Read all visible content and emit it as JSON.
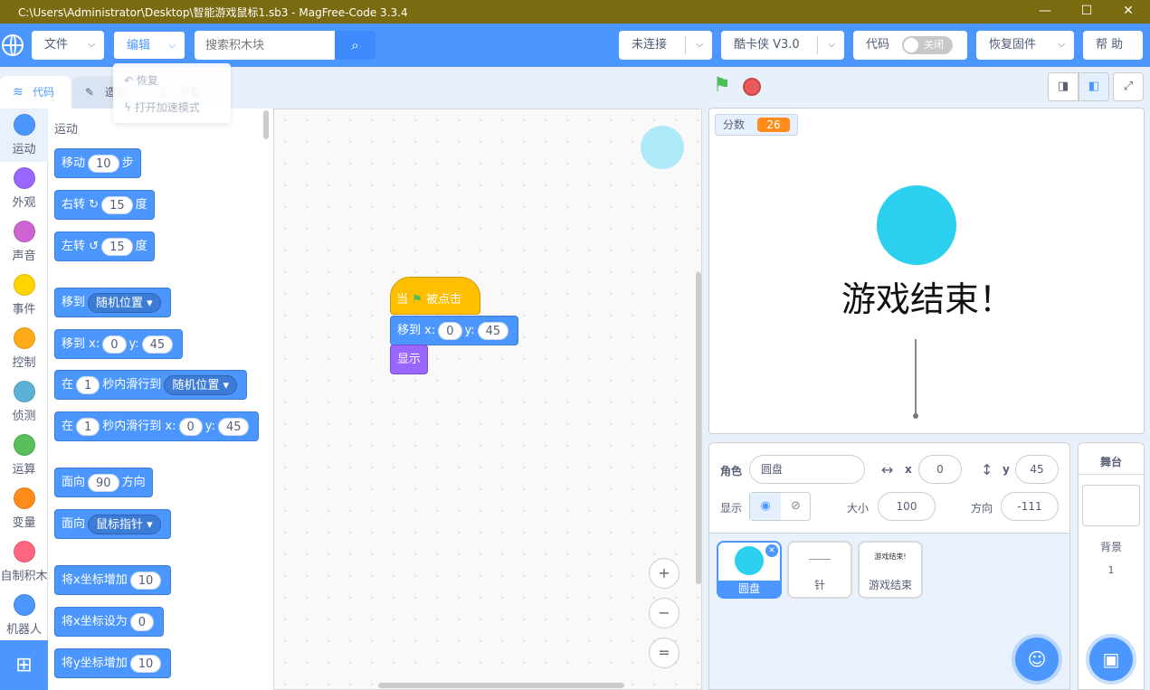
{
  "window": {
    "title": "C:\\Users\\Administrator\\Desktop\\智能游戏鼠标1.sb3 - MagFree-Code 3.3.4",
    "min_icon": "minimize-icon",
    "max_icon": "maximize-icon",
    "close_icon": "close-icon"
  },
  "menubar": {
    "file": "文件",
    "edit": "编辑",
    "search_placeholder": "搜索积木块",
    "connect": "未连接",
    "device": "酷卡侠 V3.0",
    "code_label": "代码",
    "code_toggle": "关闭",
    "restore": "恢复固件",
    "help": "帮 助"
  },
  "edit_menu": {
    "restore": "恢复",
    "turbo": "打开加速模式"
  },
  "tabs": {
    "code": "代码",
    "costume": "造型",
    "sound": "声音"
  },
  "categories": [
    {
      "label": "运动",
      "color": "#4c97ff"
    },
    {
      "label": "外观",
      "color": "#9966ff"
    },
    {
      "label": "声音",
      "color": "#cf63cf"
    },
    {
      "label": "事件",
      "color": "#ffd500"
    },
    {
      "label": "控制",
      "color": "#ffab19"
    },
    {
      "label": "侦测",
      "color": "#5cb1d6"
    },
    {
      "label": "运算",
      "color": "#59c059"
    },
    {
      "label": "变量",
      "color": "#ff8c1a"
    },
    {
      "label": "自制积木",
      "color": "#ff6680"
    },
    {
      "label": "机器人",
      "color": "#4c97ff"
    }
  ],
  "palette": {
    "heading": "运动",
    "b_move": {
      "a": "移动",
      "v": "10",
      "b": "步"
    },
    "b_turn_right": {
      "a": "右转",
      "v": "15",
      "b": "度"
    },
    "b_turn_left": {
      "a": "左转",
      "v": "15",
      "b": "度"
    },
    "b_goto": {
      "a": "移到",
      "dd": "随机位置"
    },
    "b_goto_xy": {
      "a": "移到 x:",
      "x": "0",
      "y_label": "y:",
      "y": "45"
    },
    "b_glide": {
      "a": "在",
      "v": "1",
      "b": "秒内滑行到",
      "dd": "随机位置"
    },
    "b_glide_xy": {
      "a": "在",
      "v": "1",
      "b": "秒内滑行到 x:",
      "x": "0",
      "y_label": "y:",
      "y": "45"
    },
    "b_point": {
      "a": "面向",
      "v": "90",
      "b": "方向"
    },
    "b_point_to": {
      "a": "面向",
      "dd": "鼠标指针"
    },
    "b_change_x": {
      "a": "将x坐标增加",
      "v": "10"
    },
    "b_set_x": {
      "a": "将x坐标设为",
      "v": "0"
    },
    "b_change_y": {
      "a": "将y坐标增加",
      "v": "10"
    }
  },
  "script": {
    "hat_a": "当",
    "hat_b": "被点击",
    "goto_a": "移到 x:",
    "goto_x": "0",
    "goto_y_label": "y:",
    "goto_y": "45",
    "show": "显示"
  },
  "zoom": {
    "in": "+",
    "out": "−",
    "reset": "="
  },
  "stage": {
    "var_label": "分数",
    "var_value": "26",
    "game_over": "游戏结束！"
  },
  "sprite_info": {
    "sprite_label": "角色",
    "sprite_name": "圆盘",
    "x_label": "x",
    "x": "0",
    "y_label": "y",
    "y": "45",
    "show_label": "显示",
    "size_label": "大小",
    "size": "100",
    "direction_label": "方向",
    "direction": "-111"
  },
  "sprites": [
    {
      "name": "圆盘"
    },
    {
      "name": "针"
    },
    {
      "name": "游戏结束",
      "thumb_text": "游戏结束!"
    }
  ],
  "stage_panel": {
    "title": "舞台",
    "backdrop_label": "背景",
    "backdrop_count": "1"
  },
  "colors": {
    "accent": "#4c97ff",
    "motion": "#4c97ff",
    "events": "#ffbf00",
    "looks": "#9966ff",
    "var_orange": "#ff8c1a",
    "disc": "#2ad0ee"
  }
}
